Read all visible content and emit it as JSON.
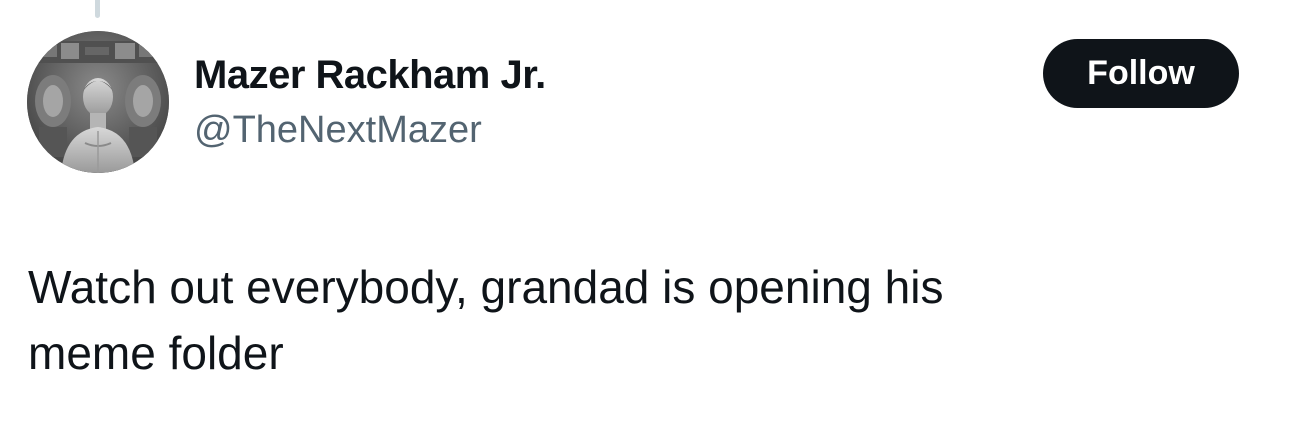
{
  "author": {
    "display_name": "Mazer Rackham Jr.",
    "handle": "@TheNextMazer",
    "avatar_icon": "profile-photo"
  },
  "actions": {
    "follow_label": "Follow"
  },
  "tweet": {
    "text": "Watch out everybody, grandad is opening his\nmeme folder"
  },
  "colors": {
    "text_primary": "#0f1419",
    "text_secondary": "#536471",
    "button_bg": "#0f1419",
    "button_text": "#ffffff",
    "thread_line": "#cfd9de"
  }
}
